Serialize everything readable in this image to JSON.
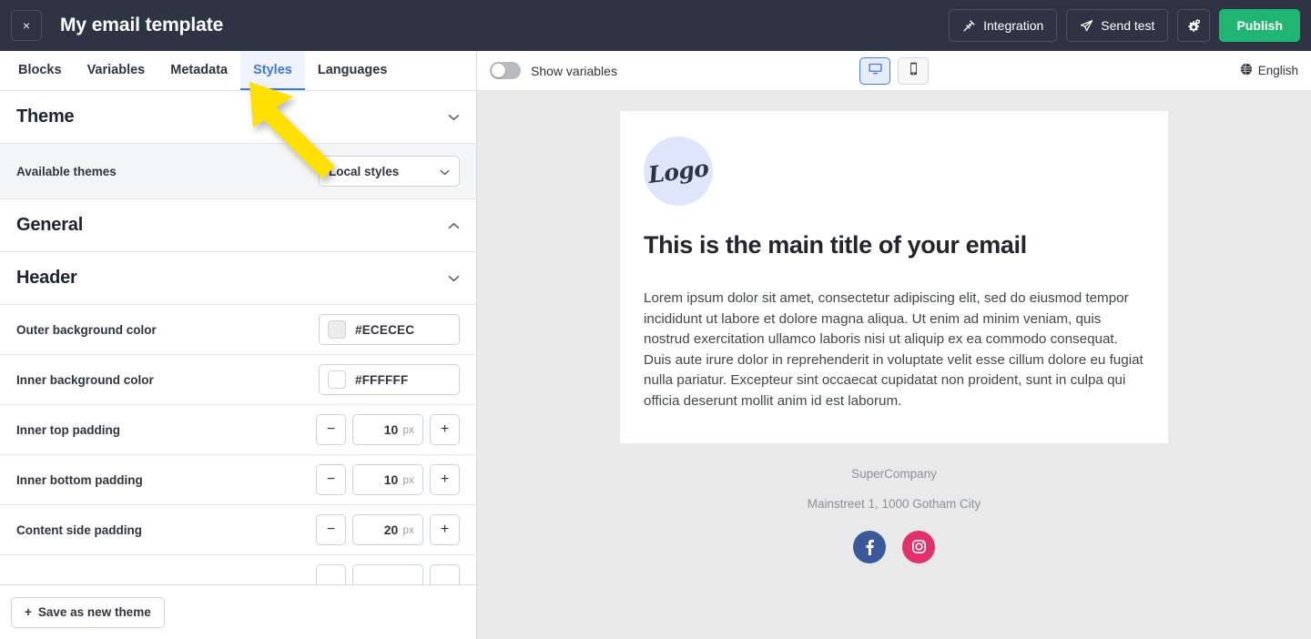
{
  "topbar": {
    "close_label": "×",
    "title": "My email template",
    "actions": [
      {
        "label": "Integration",
        "icon": "plug-icon"
      },
      {
        "label": "Send test",
        "icon": "paper-plane-icon"
      },
      {
        "label": "",
        "icon": "gears-icon"
      },
      {
        "label": "Publish",
        "icon": ""
      }
    ],
    "integration_label": "Integration",
    "send_test_label": "Send test",
    "publish_label": "Publish"
  },
  "tabs": [
    {
      "label": "Blocks",
      "active": false
    },
    {
      "label": "Variables",
      "active": false
    },
    {
      "label": "Metadata",
      "active": false
    },
    {
      "label": "Styles",
      "active": true
    },
    {
      "label": "Languages",
      "active": false
    }
  ],
  "sections": {
    "theme": {
      "title": "Theme",
      "chevron": "⌄",
      "available_themes_label": "Available themes",
      "selected_theme": "Local styles"
    },
    "general": {
      "title": "General",
      "chevron": "⌃"
    },
    "header": {
      "title": "Header",
      "chevron": "⌄"
    }
  },
  "settings": [
    {
      "label": "Outer background color",
      "type": "color",
      "value": "#ECECEC",
      "swatch": "#ECECEC"
    },
    {
      "label": "Inner background color",
      "type": "color",
      "value": "#FFFFFF",
      "swatch": "#FFFFFF"
    },
    {
      "label": "Inner top padding",
      "type": "stepper",
      "value": "10",
      "unit": "px",
      "minus": "−",
      "plus": "+"
    },
    {
      "label": "Inner bottom padding",
      "type": "stepper",
      "value": "10",
      "unit": "px",
      "minus": "−",
      "plus": "+"
    },
    {
      "label": "Content side padding",
      "type": "stepper",
      "value": "20",
      "unit": "px",
      "minus": "−",
      "plus": "+"
    }
  ],
  "panel_footer": {
    "save_theme_label": "Save as new theme",
    "plus_glyph": "+"
  },
  "preview_toolbar": {
    "show_variables_label": "Show variables",
    "show_variables_on": false,
    "devices": [
      {
        "name": "desktop",
        "active": true
      },
      {
        "name": "mobile",
        "active": false
      }
    ],
    "language_label": "English"
  },
  "email": {
    "logo_text": "Logo",
    "title": "This is the main title of your email",
    "body": "Lorem ipsum dolor sit amet, consectetur adipiscing elit, sed do eiusmod tempor incididunt ut labore et dolore magna aliqua. Ut enim ad minim veniam, quis nostrud exercitation ullamco laboris nisi ut aliquip ex ea commodo consequat. Duis aute irure dolor in reprehenderit in voluptate velit esse cillum dolore eu fugiat nulla pariatur. Excepteur sint occaecat cupidatat non proident, sunt in culpa qui officia deserunt mollit anim id est laborum.",
    "company": "SuperCompany",
    "address": "Mainstreet 1, 1000 Gotham City",
    "socials": [
      {
        "name": "facebook",
        "color": "#3b5998"
      },
      {
        "name": "instagram",
        "color": "#e1306c"
      }
    ]
  },
  "colors": {
    "topbar_bg": "#2e3444",
    "publish_green": "#20b573",
    "accent_blue": "#3f77e0",
    "cursor_yellow": "#ffe000",
    "preview_bg": "#e9e9e9",
    "logo_bg": "#dfe6fb"
  }
}
